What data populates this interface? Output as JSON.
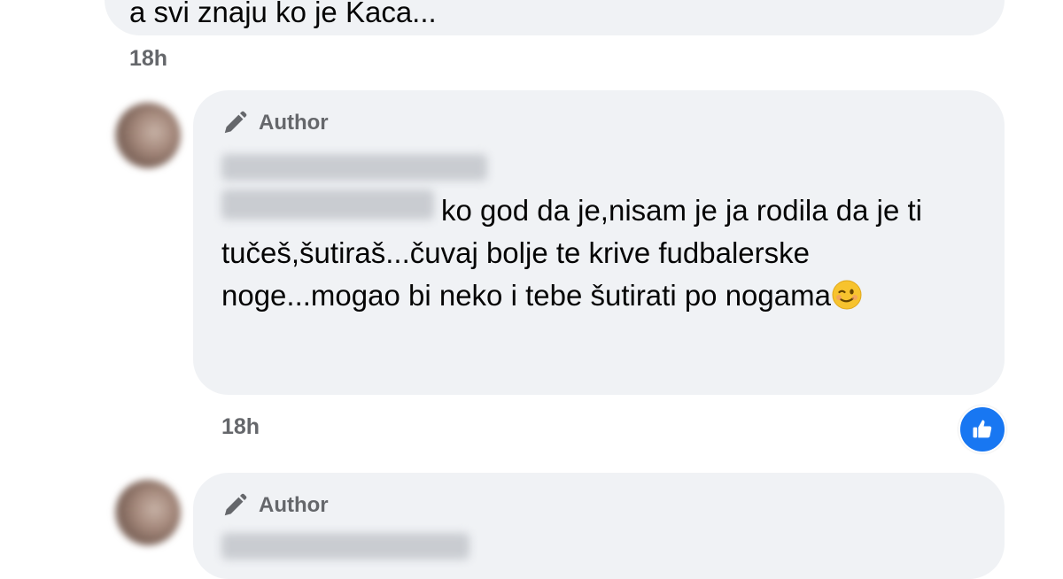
{
  "previous_comment": {
    "text": "a svi znaju ko je Kaca...",
    "time": "18h"
  },
  "comment": {
    "author_label": "Author",
    "text": "ko god da je,nisam je ja rodila da je ti tučeš,šutiraš...čuvaj bolje te krive fudbalerske noge...mogao bi neko i tebe šutirati po nogama",
    "emoji": "winking-face-icon",
    "time": "18h",
    "reaction": "like-icon"
  },
  "next_comment": {
    "author_label": "Author"
  },
  "colors": {
    "bubble": "#f0f2f5",
    "meta_text": "#65676b",
    "like_blue": "#1877f2"
  }
}
